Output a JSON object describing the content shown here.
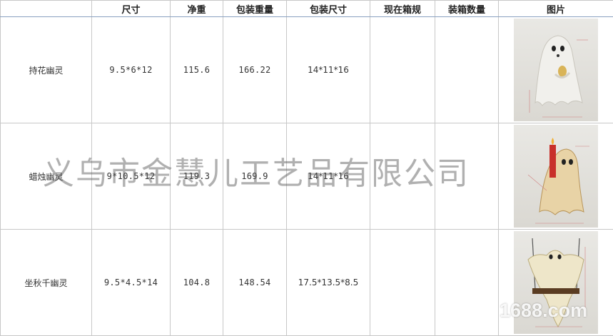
{
  "header": {
    "col0": "",
    "size": "尺寸",
    "net_weight": "净重",
    "pack_weight": "包装重量",
    "pack_size": "包装尺寸",
    "carton_spec": "现在箱规",
    "carton_qty": "装箱数量",
    "picture": "图片"
  },
  "rows": [
    {
      "name": "持花幽灵",
      "size": "9.5*6*12",
      "net_weight": "115.6",
      "pack_weight": "166.22",
      "pack_size": "14*11*16",
      "carton_spec": "",
      "carton_qty": "",
      "photo": "ghost-with-flower-photo"
    },
    {
      "name": "蜡烛幽灵",
      "size": "9*10.5*12",
      "net_weight": "119.3",
      "pack_weight": "169.9",
      "pack_size": "14*11*16",
      "carton_spec": "",
      "carton_qty": "",
      "photo": "ghost-with-candle-photo"
    },
    {
      "name": "坐秋千幽灵",
      "size": "9.5*4.5*14",
      "net_weight": "104.8",
      "pack_weight": "148.54",
      "pack_size": "17.5*13.5*8.5",
      "carton_spec": "",
      "carton_qty": "",
      "photo": "ghost-on-swing-photo"
    }
  ],
  "watermark": "义乌市金慧儿工艺品有限公司",
  "site_watermark": "1688.com",
  "site_watermark_prefix": "i",
  "colors": {
    "grid": "#c8c8c8",
    "header_rule": "#8aa0c0",
    "candle_red": "#c8302a"
  }
}
